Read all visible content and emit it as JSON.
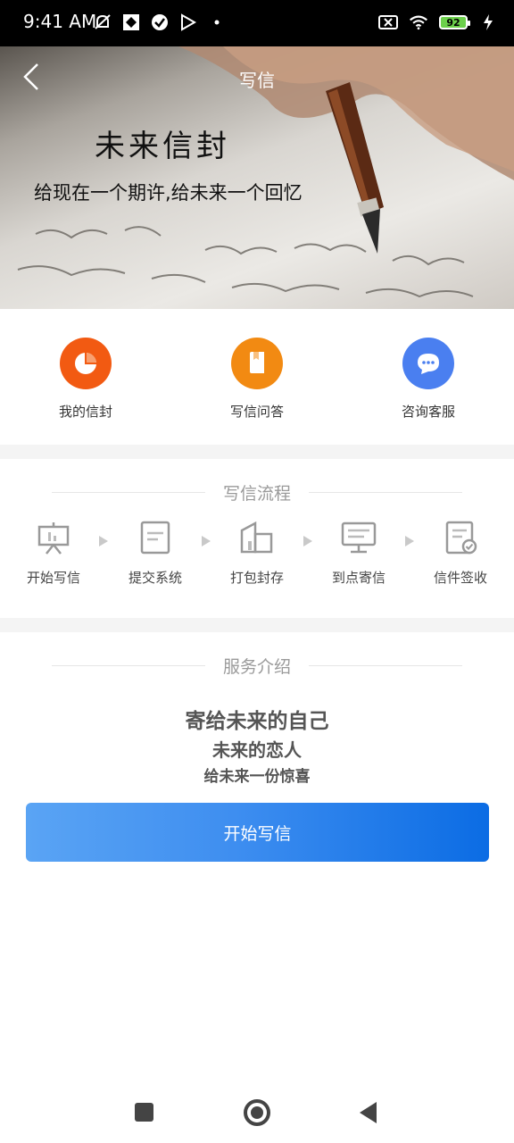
{
  "status_bar": {
    "time": "9:41 AM",
    "battery": "92"
  },
  "header": {
    "title": "写信"
  },
  "hero": {
    "title": "未来信封",
    "subtitle": "给现在一个期许,给未来一个回忆"
  },
  "quick_actions": [
    {
      "label": "我的信封",
      "color": "#f25a12"
    },
    {
      "label": "写信问答",
      "color": "#f28a12"
    },
    {
      "label": "咨询客服",
      "color": "#4a7ff0"
    }
  ],
  "process": {
    "title": "写信流程",
    "steps": [
      {
        "label": "开始写信",
        "icon": "easel-icon"
      },
      {
        "label": "提交系统",
        "icon": "document-icon"
      },
      {
        "label": "打包封存",
        "icon": "package-icon"
      },
      {
        "label": "到点寄信",
        "icon": "monitor-icon"
      },
      {
        "label": "信件签收",
        "icon": "signed-document-icon"
      }
    ]
  },
  "service": {
    "title": "服务介绍",
    "line1": "寄给未来的自己",
    "line2": "未来的恋人",
    "line3": "给未来一份惊喜",
    "button": "开始写信"
  }
}
